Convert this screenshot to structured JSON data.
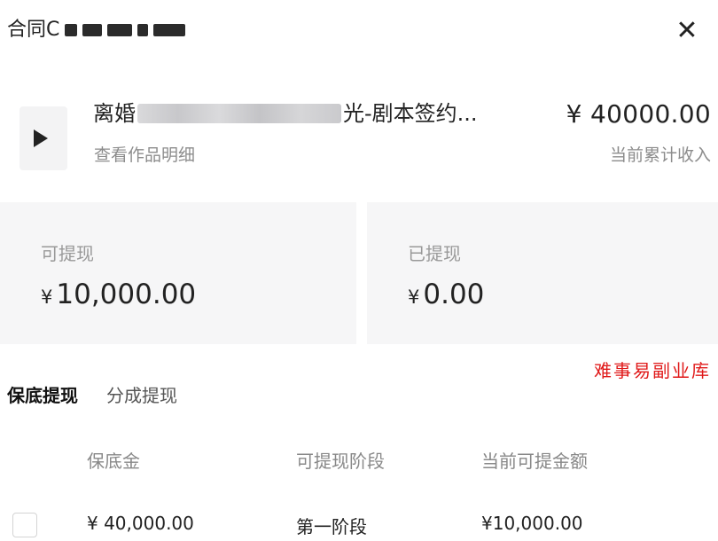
{
  "header": {
    "title_prefix": "合同C",
    "close_icon": "✕"
  },
  "work": {
    "title_start": "离婚",
    "title_end": "光-剧本签约...",
    "link": "查看作品明细",
    "play_icon": "play-icon"
  },
  "income": {
    "amount": "¥ 40000.00",
    "label": "当前累计收入"
  },
  "balance": {
    "withdrawable_label": "可提现",
    "withdrawable_currency": "¥",
    "withdrawable_value": "10,000.00",
    "withdrawn_label": "已提现",
    "withdrawn_currency": "¥",
    "withdrawn_value": "0.00"
  },
  "watermark": "难事易副业库",
  "tabs": [
    {
      "label": "保底提现",
      "active": true
    },
    {
      "label": "分成提现",
      "active": false
    }
  ],
  "table": {
    "headers": [
      "保底金",
      "可提现阶段",
      "当前可提金额"
    ],
    "rows": [
      {
        "guarantee": "¥ 40,000.00",
        "stage": "第一阶段",
        "amount": "¥10,000.00"
      }
    ]
  },
  "colors": {
    "text": "#222222",
    "muted": "#8c8c8c",
    "card_bg": "#f6f6f7",
    "watermark": "#e01a1a"
  }
}
